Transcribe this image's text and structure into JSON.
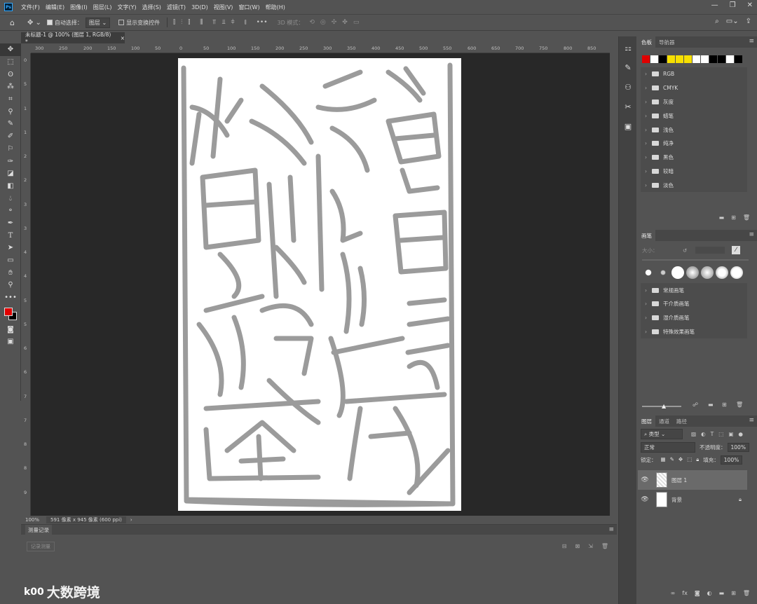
{
  "menu": [
    "文件(F)",
    "编辑(E)",
    "图像(I)",
    "图层(L)",
    "文字(Y)",
    "选择(S)",
    "滤镜(T)",
    "3D(D)",
    "视图(V)",
    "窗口(W)",
    "帮助(H)"
  ],
  "options": {
    "auto_select": "自动选择：",
    "auto_select_target": "图层",
    "show_transform": "显示变换控件",
    "mode3d": "3D 模式："
  },
  "document": {
    "tab_title": "未标题-1 @ 100% (图层 1, RGB/8) *",
    "close": "×"
  },
  "ruler_h": [
    "300",
    "250",
    "200",
    "150",
    "100",
    "50",
    "0",
    "50",
    "100",
    "150",
    "200",
    "250",
    "300",
    "350",
    "400",
    "450",
    "500",
    "550",
    "600",
    "650",
    "700",
    "750",
    "800",
    "850"
  ],
  "ruler_v": [
    "0",
    "5",
    "1",
    "1",
    "2",
    "2",
    "3",
    "3",
    "4",
    "4",
    "5",
    "5",
    "6",
    "6",
    "7",
    "7",
    "8",
    "8",
    "9"
  ],
  "status": {
    "zoom": "100%",
    "info": "591 像素 x 945 像素 (600 ppi)",
    "arrow": "›"
  },
  "history": {
    "tab": "测量记录",
    "record_button": "记录测量"
  },
  "watermark": {
    "logo": "k00",
    "text": "大数跨境"
  },
  "swatches_panel": {
    "tabs": [
      "色板",
      "导航器"
    ],
    "colors": [
      "#e00000",
      "#ffffff",
      "#000000",
      "#f7e000",
      "#f7e000",
      "#f7e000",
      "#ffffff",
      "#ffffff",
      "#000000",
      "#000000",
      "#ffffff",
      "#000000"
    ],
    "groups": [
      "RGB",
      "CMYK",
      "灰度",
      "蜡笔",
      "浅色",
      "纯净",
      "黑色",
      "较暗",
      "淡色"
    ]
  },
  "brushes_panel": {
    "tab": "画笔",
    "size_label": "大小：",
    "groups": [
      "常规画笔",
      "干介质画笔",
      "湿介质画笔",
      "特殊效果画笔"
    ]
  },
  "layers_panel": {
    "tabs": [
      "图层",
      "通道",
      "路径"
    ],
    "filter": "类型",
    "blend_mode": "正常",
    "opacity_label": "不透明度：",
    "opacity": "100%",
    "lock_label": "锁定：",
    "fill_label": "填充：",
    "fill": "100%",
    "layers": [
      {
        "name": "图层 1",
        "selected": true
      },
      {
        "name": "背景",
        "selected": false,
        "locked": true
      }
    ]
  }
}
